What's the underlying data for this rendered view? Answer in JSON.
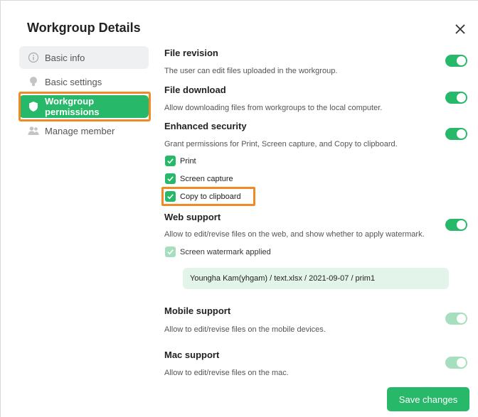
{
  "dialog": {
    "title": "Workgroup Details",
    "close_icon": "close-icon"
  },
  "sidebar": {
    "items": [
      {
        "label": "Basic info",
        "icon": "info-icon",
        "active": false
      },
      {
        "label": "Basic settings",
        "icon": "bulb-icon",
        "active": false
      },
      {
        "label": "Workgroup permissions",
        "icon": "shield-icon",
        "active": true
      },
      {
        "label": "Manage member",
        "icon": "people-icon",
        "active": false
      }
    ]
  },
  "permissions": {
    "file_revision": {
      "title": "File revision",
      "desc": "The user can edit files uploaded in the workgroup.",
      "enabled": true
    },
    "file_download": {
      "title": "File download",
      "desc": "Allow downloading files from workgroups to the local computer.",
      "enabled": true
    },
    "enhanced_security": {
      "title": "Enhanced security",
      "desc": "Grant permissions for Print, Screen capture, and Copy to clipboard.",
      "enabled": true,
      "options": [
        {
          "label": "Print",
          "checked": true
        },
        {
          "label": "Screen capture",
          "checked": true
        },
        {
          "label": "Copy to clipboard",
          "checked": true
        }
      ]
    },
    "web_support": {
      "title": "Web support",
      "desc": "Allow to edit/revise files on the web, and show whether to apply watermark.",
      "enabled": true,
      "watermark_option": {
        "label": "Screen watermark applied",
        "checked": true,
        "disabled": true
      },
      "watermark_preview": "Youngha Kam(yhgam) / text.xlsx / 2021-09-07 / prim1"
    },
    "mobile_support": {
      "title": "Mobile support",
      "desc": "Allow to edit/revise files on the mobile devices.",
      "enabled": true,
      "disabled": true
    },
    "mac_support": {
      "title": "Mac support",
      "desc": "Allow to edit/revise files on the mac.",
      "enabled": true,
      "disabled": true
    }
  },
  "footer": {
    "save_label": "Save changes"
  },
  "colors": {
    "accent": "#27b86a",
    "accent_disabled": "#a6dfbe",
    "highlight": "#f08a24"
  }
}
